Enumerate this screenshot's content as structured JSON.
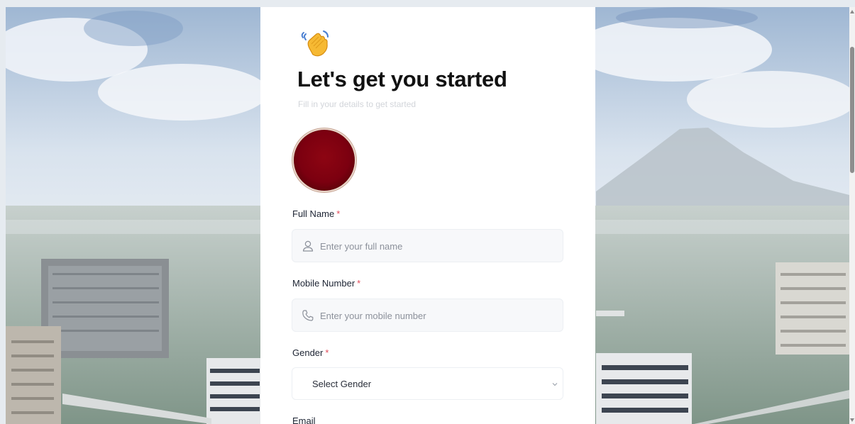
{
  "form": {
    "greeting_icon": "waving-hand-icon",
    "title": "Let's get you started",
    "subtitle": "Fill in your details to get started",
    "avatar_color": "#7c0010",
    "required_marker": "*",
    "fields": {
      "full_name": {
        "label": "Full Name",
        "placeholder": "Enter your full name",
        "icon": "user-icon"
      },
      "mobile": {
        "label": "Mobile Number",
        "placeholder": "Enter your mobile number",
        "icon": "phone-icon"
      },
      "gender": {
        "label": "Gender",
        "selected": "Select Gender",
        "icon": "chevron-down-icon"
      },
      "email": {
        "label": "Email"
      }
    }
  },
  "colors": {
    "required": "#e24b5a",
    "title": "#111111",
    "input_bg": "#f7f8fa"
  }
}
